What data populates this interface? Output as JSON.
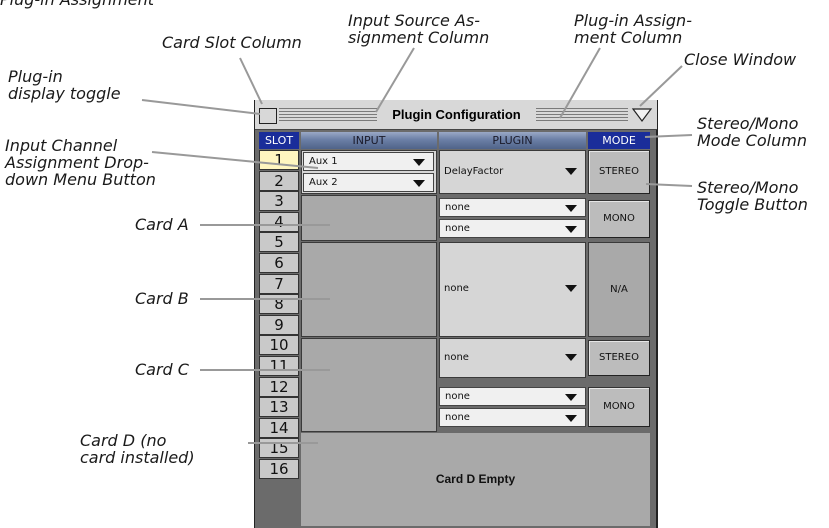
{
  "callouts": {
    "top_left_fragment": "Plug-in Assignment",
    "card_slot_column": "Card Slot Column",
    "input_source_column_l1": "Input Source As-",
    "input_source_column_l2": "signment Column",
    "plugin_assignment_l1": "Plug-in Assign-",
    "plugin_assignment_l2": "ment Column",
    "close_window": "Close Window",
    "plugin_display_toggle_l1": "Plug-in",
    "plugin_display_toggle_l2": "display toggle",
    "input_channel_l1": "Input Channel",
    "input_channel_l2": "Assignment Drop-",
    "input_channel_l3": "down Menu Button",
    "stereo_mono_column_l1": "Stereo/Mono",
    "stereo_mono_column_l2": "Mode Column",
    "stereo_mono_toggle_l1": "Stereo/Mono",
    "stereo_mono_toggle_l2": "Toggle Button",
    "card_a": "Card A",
    "card_b": "Card B",
    "card_c": "Card C",
    "card_d_l1": "Card D (no",
    "card_d_l2": "card installed)"
  },
  "window": {
    "title": "Plugin Configuration",
    "headers": {
      "slot": "SLOT",
      "input": "INPUT",
      "plugin": "PLUGIN",
      "mode": "MODE"
    },
    "slots": [
      "1",
      "2",
      "3",
      "4",
      "5",
      "6",
      "7",
      "8",
      "9",
      "10",
      "11",
      "12",
      "13",
      "14",
      "15",
      "16"
    ],
    "inputs": {
      "slot1": "Aux 1",
      "slot2": "Aux 2"
    },
    "plugins": {
      "card_a_top": "DelayFactor",
      "slot3": "none",
      "slot4": "none",
      "card_b": "none",
      "card_c_top": "none",
      "slot11": "none",
      "slot12": "none"
    },
    "modes": {
      "slots_1_2": "STEREO",
      "slots_3_4": "MONO",
      "slots_5_8": "N/A",
      "slots_9_10": "STEREO",
      "slots_11_12": "MONO"
    },
    "empty_card": "Card D Empty"
  },
  "colors": {
    "header_blue": "#1a2d9a",
    "selected_slot": "#fff6c0",
    "panel_gray": "#a9a9a9"
  }
}
